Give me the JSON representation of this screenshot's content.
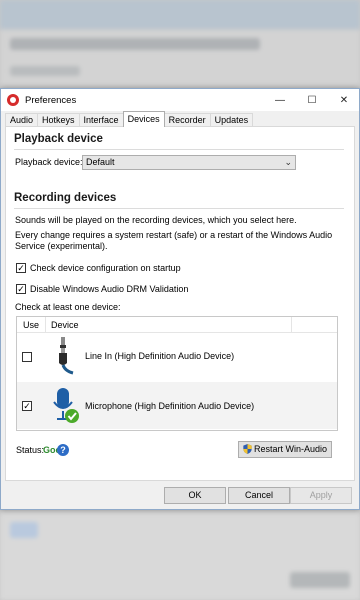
{
  "window": {
    "title": "Preferences"
  },
  "tabs": [
    "Audio",
    "Hotkeys",
    "Interface",
    "Devices",
    "Recorder",
    "Updates"
  ],
  "active_tab": "Devices",
  "playback": {
    "heading": "Playback device",
    "label": "Playback device:",
    "value": "Default"
  },
  "recording": {
    "heading": "Recording devices",
    "desc1": "Sounds will be played on the recording devices, which you select here.",
    "desc2": "Every change requires a system restart (safe) or a restart of the Windows Audio",
    "desc3": "Service (experimental).",
    "check_config": {
      "label": "Check device configuration on startup",
      "checked": true
    },
    "disable_drm": {
      "label": "Disable Windows Audio DRM Validation",
      "checked": true
    },
    "check_note": "Check at least one device:",
    "columns": {
      "use": "Use",
      "device": "Device"
    },
    "devices": [
      {
        "name": "Line In (High Definition Audio Device)",
        "checked": false,
        "icon": "line-in-jack-icon"
      },
      {
        "name": "Microphone (High Definition Audio Device)",
        "checked": true,
        "icon": "microphone-icon"
      }
    ]
  },
  "status": {
    "label": "Status:",
    "value": "Good",
    "color": "#2e8b2e",
    "help": "?"
  },
  "restart_button": "Restart Win-Audio",
  "footer": {
    "ok": "OK",
    "cancel": "Cancel",
    "apply": "Apply"
  }
}
